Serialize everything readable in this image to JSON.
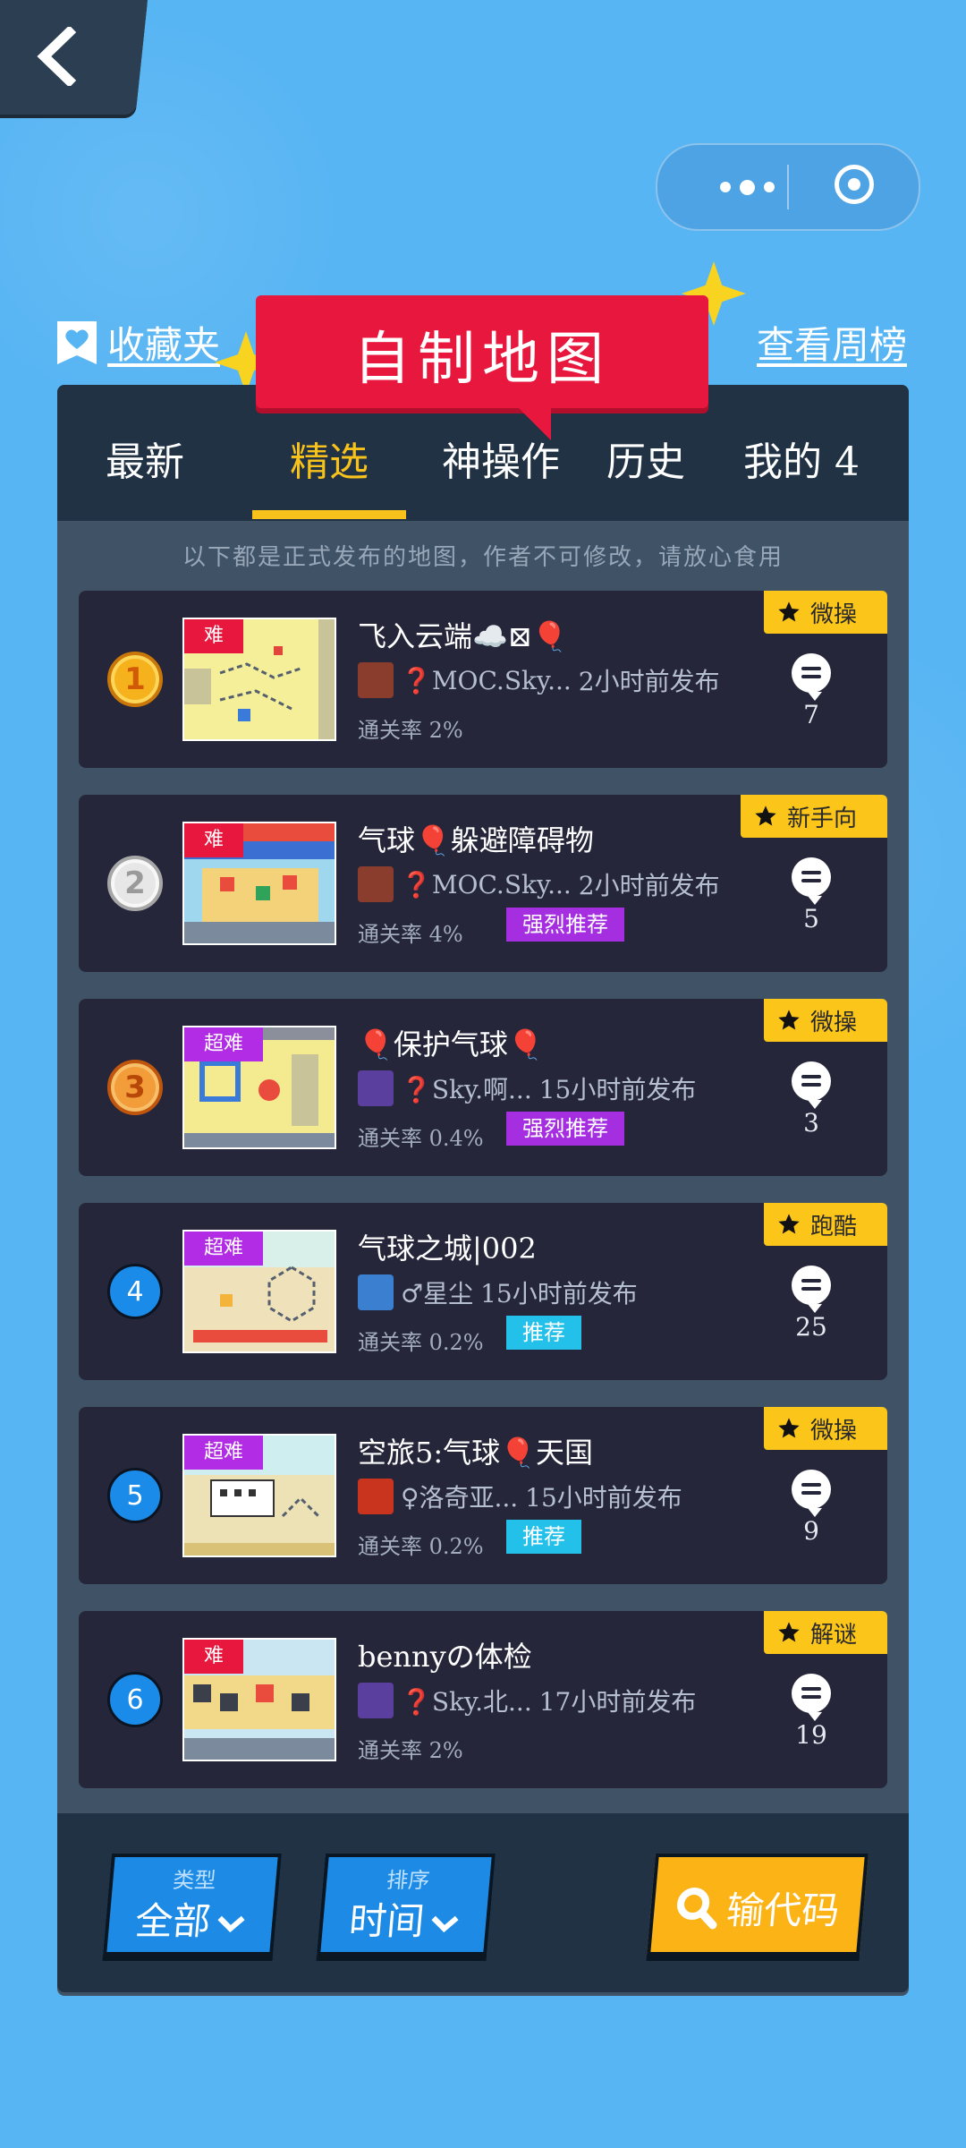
{
  "header": {
    "favorites_label": "收藏夹",
    "title": "自制地图",
    "weekly_label": "查看周榜"
  },
  "tabs": [
    {
      "label": "最新",
      "active": false
    },
    {
      "label": "精选",
      "active": true
    },
    {
      "label": "神操作",
      "active": false
    },
    {
      "label": "历史",
      "active": false
    },
    {
      "label": "我的 4",
      "active": false
    }
  ],
  "notice": "以下都是正式发布的地图，作者不可修改，请放心食用",
  "maps": [
    {
      "rank": "1",
      "difficulty": "难",
      "title": "飞入云端☁️⊠🎈",
      "author": "❓MOC.Sky...",
      "published": "2小时前发布",
      "pass_rate": "通关率 2%",
      "recommend": "",
      "tag": "微操",
      "comments": "7"
    },
    {
      "rank": "2",
      "difficulty": "难",
      "title": "气球🎈躲避障碍物",
      "author": "❓MOC.Sky...",
      "published": "2小时前发布",
      "pass_rate": "通关率 4%",
      "recommend": "强烈推荐",
      "tag": "新手向",
      "comments": "5"
    },
    {
      "rank": "3",
      "difficulty": "超难",
      "title": "🎈保护气球🎈",
      "author": "❓Sky.啊...",
      "published": "15小时前发布",
      "pass_rate": "通关率 0.4%",
      "recommend": "强烈推荐",
      "tag": "微操",
      "comments": "3"
    },
    {
      "rank": "4",
      "difficulty": "超难",
      "title": "气球之城|002",
      "author": "♂星尘",
      "published": "15小时前发布",
      "pass_rate": "通关率 0.2%",
      "recommend": "推荐",
      "tag": "跑酷",
      "comments": "25"
    },
    {
      "rank": "5",
      "difficulty": "超难",
      "title": "空旅5:气球🎈天国",
      "author": "♀洛奇亚...",
      "published": "15小时前发布",
      "pass_rate": "通关率 0.2%",
      "recommend": "推荐",
      "tag": "微操",
      "comments": "9"
    },
    {
      "rank": "6",
      "difficulty": "难",
      "title": "bennyの体检",
      "author": "❓Sky.北...",
      "published": "17小时前发布",
      "pass_rate": "通关率 2%",
      "recommend": "",
      "tag": "解谜",
      "comments": "19"
    }
  ],
  "bottom": {
    "type_label": "类型",
    "type_value": "全部",
    "sort_label": "排序",
    "sort_value": "时间",
    "code_button": "输代码"
  },
  "colors": {
    "background": "#58b5f3",
    "accent_yellow": "#fcc51a",
    "banner_red": "#e8173d",
    "card": "#25263a",
    "strong_recommend": "#a42ee0",
    "recommend": "#23c0ea"
  }
}
